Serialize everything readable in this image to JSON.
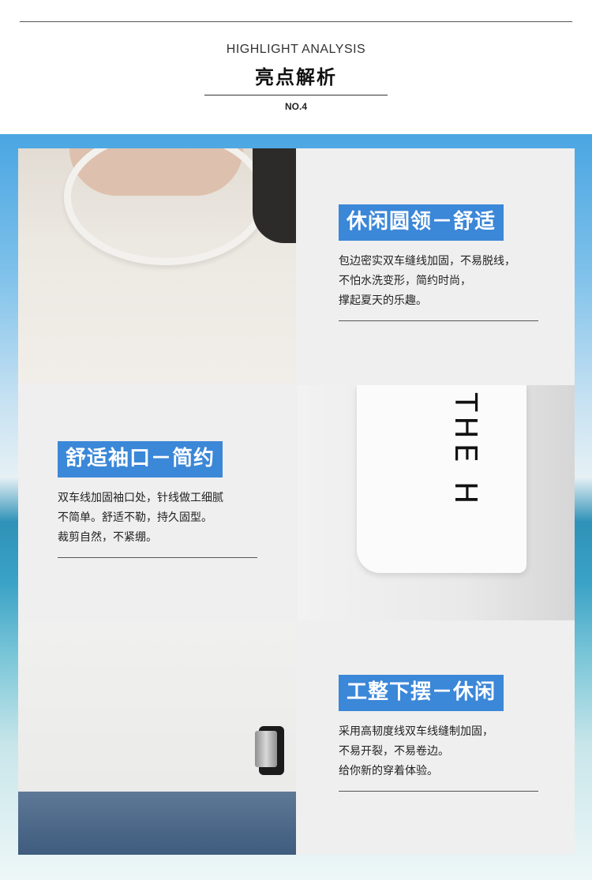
{
  "header": {
    "subtitle_en": "HIGHLIGHT ANALYSIS",
    "title_cn": "亮点解析",
    "number": "NO.4"
  },
  "features": [
    {
      "title": "休闲圆领－舒适",
      "lines": [
        "包边密实双车缝线加固，不易脱线，",
        "不怕水洗变形，简约时尚，",
        "撑起夏天的乐趣。"
      ]
    },
    {
      "title": "舒适袖口－简约",
      "lines": [
        "双车线加固袖口处，针线做工细腻",
        "不简单。舒适不勒，持久固型。",
        "裁剪自然，不紧绷。"
      ]
    },
    {
      "title": "工整下摆－休闲",
      "lines": [
        "采用高韧度线双车线缝制加固，",
        "不易开裂，不易卷边。",
        "给你新的穿着体验。"
      ]
    }
  ],
  "photos": {
    "sleeve_text": "THE H"
  },
  "colors": {
    "accent": "#3b87d8",
    "panel": "#efefef"
  }
}
